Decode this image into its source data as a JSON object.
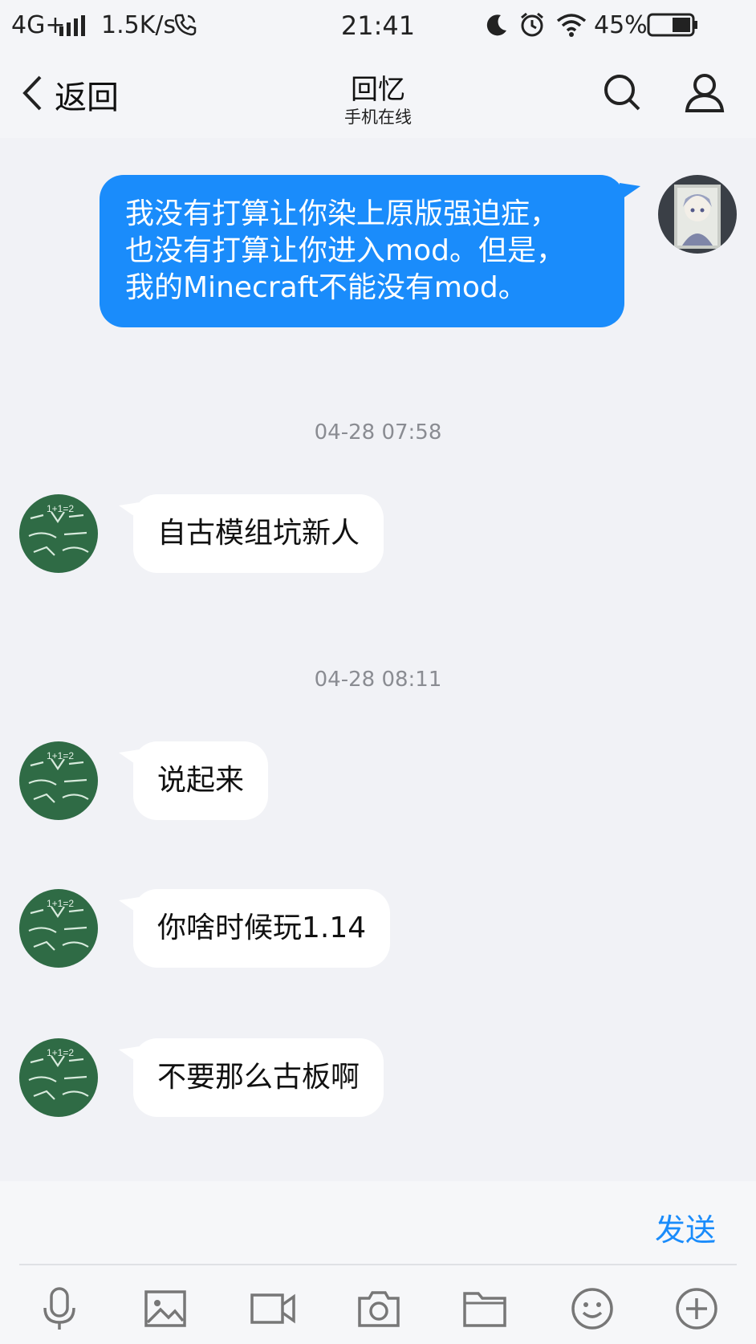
{
  "status_bar": {
    "network": "4G+",
    "speed": "1.5K/s",
    "time": "21:41",
    "battery": "45%",
    "icons": [
      "signal-bars-icon",
      "phone-call-icon",
      "moon-icon",
      "alarm-icon",
      "wifi-icon",
      "battery-icon"
    ]
  },
  "header": {
    "back_label": "返回",
    "title": "回忆",
    "subtitle": "手机在线",
    "icons": [
      "back-chevron-icon",
      "search-icon",
      "profile-icon"
    ]
  },
  "messages": [
    {
      "side": "right",
      "text": "我没有打算让你染上原版强迫症，\n也没有打算让你进入mod。但是，\n我的Minecraft不能没有mod。"
    },
    {
      "type": "timestamp",
      "text": "04-28 07:58"
    },
    {
      "side": "left",
      "text": "自古模组坑新人"
    },
    {
      "type": "timestamp",
      "text": "04-28 08:11"
    },
    {
      "side": "left",
      "text": "说起来"
    },
    {
      "side": "left",
      "text": "你啥时候玩1.14"
    },
    {
      "side": "left",
      "text": "不要那么古板啊"
    }
  ],
  "input": {
    "send_label": "发送",
    "toolbar_icons": [
      "microphone-icon",
      "image-icon",
      "video-icon",
      "camera-icon",
      "folder-icon",
      "emoji-icon",
      "plus-icon"
    ]
  },
  "colors": {
    "accent": "#1a8cfb",
    "background": "#f1f2f6",
    "bubble_left": "#ffffff",
    "avatar_green": "#2f6b45"
  }
}
